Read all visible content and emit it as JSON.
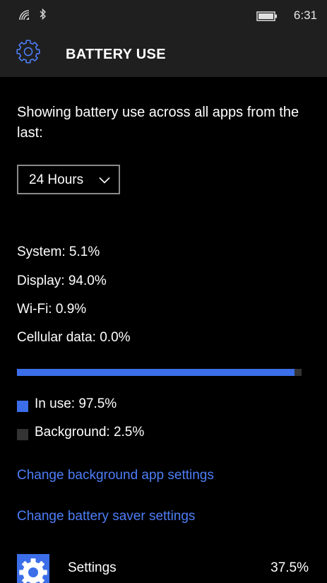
{
  "status_bar": {
    "time": "6:31",
    "icons": [
      "wifi-signal-icon",
      "bluetooth-icon",
      "battery-icon"
    ]
  },
  "header": {
    "icon": "gear-icon",
    "title": "BATTERY USE"
  },
  "intro_text": "Showing battery use across all apps from the last:",
  "period_select": {
    "selected": "24 Hours",
    "icon": "chevron-down-icon"
  },
  "breakdown": {
    "system": "System: 5.1%",
    "display": "Display: 94.0%",
    "wifi": "Wi-Fi: 0.9%",
    "cellular": "Cellular data: 0.0%"
  },
  "usage_bar": {
    "in_use_percent": 97.5,
    "fill_color": "#3b6ee8",
    "track_color": "#333333"
  },
  "legend": {
    "in_use": "In use: 97.5%",
    "background": "Background: 2.5%",
    "in_use_color": "#3b6ee8",
    "background_color": "#333333"
  },
  "links": {
    "background_apps": "Change background app settings",
    "battery_saver": "Change battery saver settings"
  },
  "apps": [
    {
      "name": "Settings",
      "percent": "37.5%",
      "icon": "settings-gear-icon"
    }
  ],
  "colors": {
    "accent": "#3b6ee8",
    "link": "#4d7ef7",
    "header_bg": "#1f1f1f",
    "page_bg": "#000000"
  }
}
